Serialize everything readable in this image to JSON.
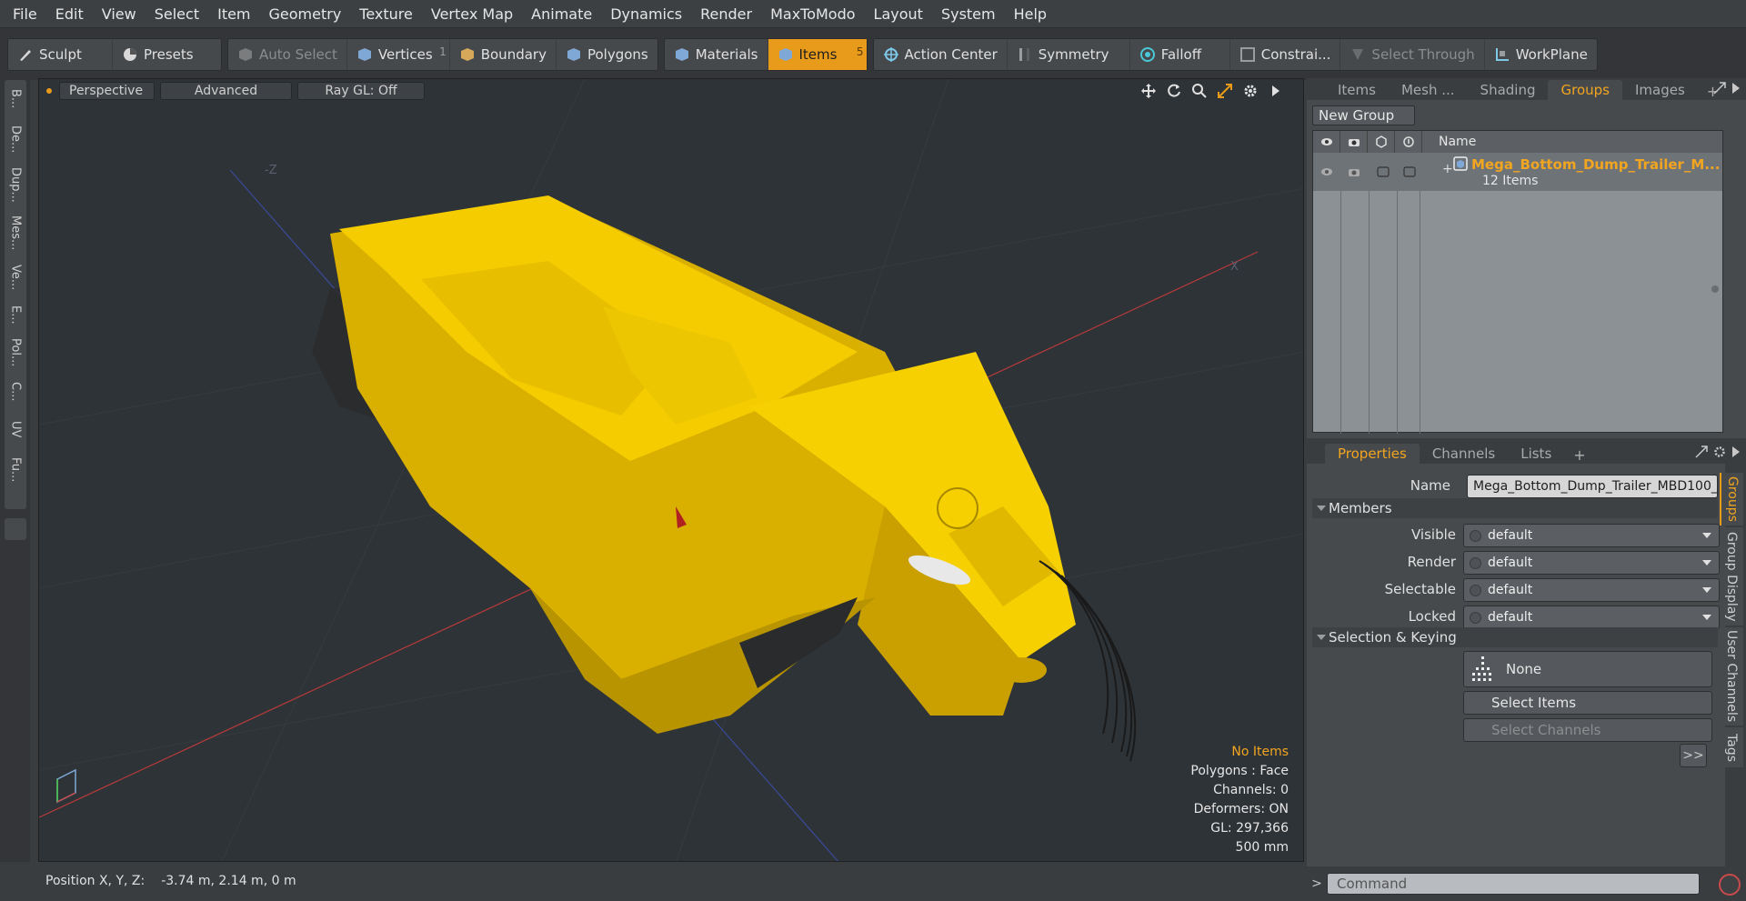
{
  "menubar": {
    "items": [
      "File",
      "Edit",
      "View",
      "Select",
      "Item",
      "Geometry",
      "Texture",
      "Vertex Map",
      "Animate",
      "Dynamics",
      "Render",
      "MaxToModo",
      "Layout",
      "System",
      "Help"
    ]
  },
  "toolbar": {
    "sculpt": "Sculpt",
    "presets": "Presets",
    "auto_select": "Auto Select",
    "vertices": "Vertices",
    "vertices_count": "1",
    "boundary": "Boundary",
    "polygons": "Polygons",
    "materials": "Materials",
    "items": "Items",
    "items_count": "5",
    "action_center": "Action Center",
    "symmetry": "Symmetry",
    "falloff": "Falloff",
    "constraints": "Constrai...",
    "select_through": "Select Through",
    "workplane": "WorkPlane"
  },
  "left_tabs": [
    "B...",
    "De...",
    "Dup...",
    "Mes...",
    "Ve...",
    "E...",
    "Pol...",
    "C...",
    "UV",
    "Fu..."
  ],
  "viewport": {
    "view_mode": "Perspective",
    "shading": "Advanced",
    "raygl": "Ray GL: Off",
    "axis_labels": {
      "neg_z": "-Z",
      "x": "X"
    },
    "stats": {
      "selection": "No Items",
      "polygons": "Polygons : Face",
      "channels": "Channels: 0",
      "deformers": "Deformers: ON",
      "gl": "GL: 297,366",
      "scale": "500 mm"
    }
  },
  "statusbar": {
    "label": "Position X, Y, Z:",
    "value": "-3.74 m, 2.14 m, 0 m"
  },
  "top_panel": {
    "tabs": [
      "Items",
      "Mesh ...",
      "Shading",
      "Groups",
      "Images"
    ],
    "active_tab": "Groups",
    "new_group": "New Group",
    "name_header": "Name",
    "group_name": "Mega_Bottom_Dump_Trailer_M...",
    "group_count": "12 Items"
  },
  "props_panel": {
    "tabs": [
      "Properties",
      "Channels",
      "Lists"
    ],
    "name_label": "Name",
    "name_value": "Mega_Bottom_Dump_Trailer_MBD100_",
    "members_section": "Members",
    "visible_label": "Visible",
    "visible_value": "default",
    "render_label": "Render",
    "render_value": "default",
    "selectable_label": "Selectable",
    "selectable_value": "default",
    "locked_label": "Locked",
    "locked_value": "default",
    "sel_section": "Selection & Keying",
    "none_label": "None",
    "select_items": "Select Items",
    "select_channels": "Select Channels",
    "expand": ">>"
  },
  "right_vtabs": [
    "Groups",
    "Group Display",
    "User Channels",
    "Tags"
  ],
  "command": {
    "prompt": ">",
    "placeholder": "Command"
  },
  "colors": {
    "accent": "#e89a1a",
    "trailer": "#f2c200",
    "viewport_bg": "#2e3337"
  }
}
